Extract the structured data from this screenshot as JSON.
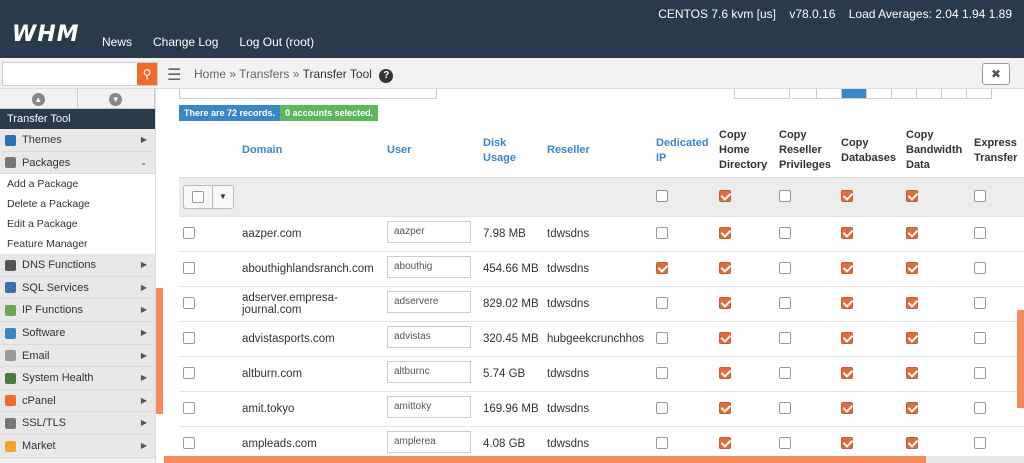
{
  "header": {
    "logo": "WHM",
    "nav": [
      "News",
      "Change Log",
      "Log Out (root)"
    ],
    "os": "CENTOS 7.6 kvm [us]",
    "version": "v78.0.16",
    "load": "Load Averages: 2.04 1.94 1.89"
  },
  "search": {
    "placeholder": ""
  },
  "breadcrumb": {
    "home": "Home",
    "sep": "»",
    "section": "Transfers",
    "current": "Transfer Tool"
  },
  "sidebar": {
    "active": "Transfer Tool",
    "items": [
      {
        "label": "Themes",
        "icon_color": "#2b6fb5"
      },
      {
        "label": "Packages",
        "icon_color": "#777777",
        "sub": [
          "Add a Package",
          "Delete a Package",
          "Edit a Package",
          "Feature Manager"
        ]
      },
      {
        "label": "DNS Functions",
        "icon_color": "#555555"
      },
      {
        "label": "SQL Services",
        "icon_color": "#3a6fa8"
      },
      {
        "label": "IP Functions",
        "icon_color": "#6aa84f"
      },
      {
        "label": "Software",
        "icon_color": "#3b86c6"
      },
      {
        "label": "Email",
        "icon_color": "#999999"
      },
      {
        "label": "System Health",
        "icon_color": "#4a7a3a"
      },
      {
        "label": "cPanel",
        "icon_color": "#f26b2d"
      },
      {
        "label": "SSL/TLS",
        "icon_color": "#777777"
      },
      {
        "label": "Market",
        "icon_color": "#f2a12d"
      }
    ]
  },
  "main": {
    "records_label": "There are 72 records.",
    "selected_label": "0 accounts selected.",
    "columns": [
      "Domain",
      "User",
      "Disk Usage",
      "Reseller",
      "Dedicated IP",
      "Copy Home Directory",
      "Copy Reseller Privileges",
      "Copy Databases",
      "Copy Bandwidth Data",
      "Express Transfer"
    ],
    "filter_checks": [
      false,
      true,
      false,
      true,
      true,
      false
    ],
    "rows": [
      {
        "domain": "aazper.com",
        "user": "aazper",
        "disk": "7.98 MB",
        "reseller": "tdwsdns",
        "checks": [
          false,
          true,
          false,
          true,
          true,
          false
        ]
      },
      {
        "domain": "abouthighlandsranch.com",
        "user": "abouthig",
        "disk": "454.66 MB",
        "reseller": "tdwsdns",
        "checks": [
          true,
          true,
          false,
          true,
          true,
          false
        ]
      },
      {
        "domain": "adserver.empresa-journal.com",
        "user": "adservere",
        "disk": "829.02 MB",
        "reseller": "tdwsdns",
        "checks": [
          false,
          true,
          false,
          true,
          true,
          false
        ]
      },
      {
        "domain": "advistasports.com",
        "user": "advistas",
        "disk": "320.45 MB",
        "reseller": "hubgeekcrunchhos",
        "checks": [
          false,
          true,
          false,
          true,
          true,
          false
        ]
      },
      {
        "domain": "altburn.com",
        "user": "altburnc",
        "disk": "5.74 GB",
        "reseller": "tdwsdns",
        "checks": [
          false,
          true,
          false,
          true,
          true,
          false
        ]
      },
      {
        "domain": "amit.tokyo",
        "user": "amittoky",
        "disk": "169.96 MB",
        "reseller": "tdwsdns",
        "checks": [
          false,
          true,
          false,
          true,
          true,
          false
        ]
      },
      {
        "domain": "ampleads.com",
        "user": "amplerea",
        "disk": "4.08 GB",
        "reseller": "tdwsdns",
        "checks": [
          false,
          true,
          false,
          true,
          true,
          false
        ]
      }
    ]
  }
}
